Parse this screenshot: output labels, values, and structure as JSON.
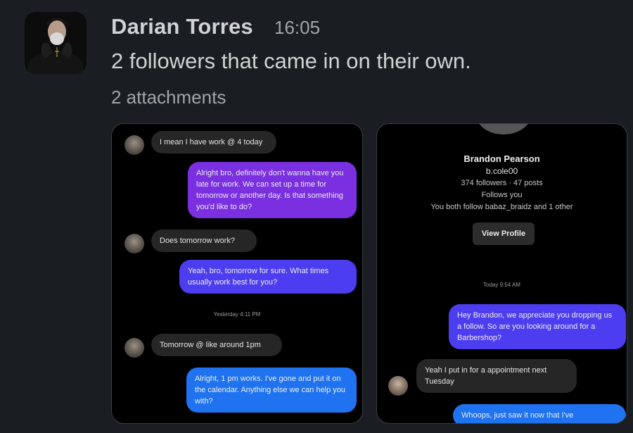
{
  "message": {
    "author": "Darian Torres",
    "time": "16:05",
    "text": "2 followers that came in on their own.",
    "attachments_label": "2 attachments"
  },
  "attachment1": {
    "messages": [
      {
        "text": "I mean I have work @ 4 today"
      },
      {
        "text": "Alright bro, definitely don't wanna have you late for work. We can set up a time for tomorrow or another day. Is that something you'd like to do?"
      },
      {
        "text": "Does tomorrow work?"
      },
      {
        "text": "Yeah, bro, tomorrow for sure. What times usually work best for you?"
      },
      {
        "text": "Tomorrow @ like around 1pm"
      },
      {
        "text": "Alright, 1 pm works. I've gone and put it on the calendar. Anything else we can help you with?"
      }
    ],
    "timestamp": "Yesterday 4:11 PM"
  },
  "attachment2": {
    "profile": {
      "name": "Brandon Pearson",
      "username": "b.cole00",
      "stats": "374 followers · 47 posts",
      "follows_you": "Follows you",
      "mutual": "You both follow babaz_braidz and 1 other",
      "button": "View Profile"
    },
    "timestamp": "Today 9:54 AM",
    "messages": [
      {
        "text": "Hey Brandon,  we appreciate you dropping us a follow. So are you looking around for a Barbershop?"
      },
      {
        "text": "Yeah I put in for a appointment next Tuesday"
      },
      {
        "text": "Whoops, just saw it now that I've"
      }
    ]
  }
}
